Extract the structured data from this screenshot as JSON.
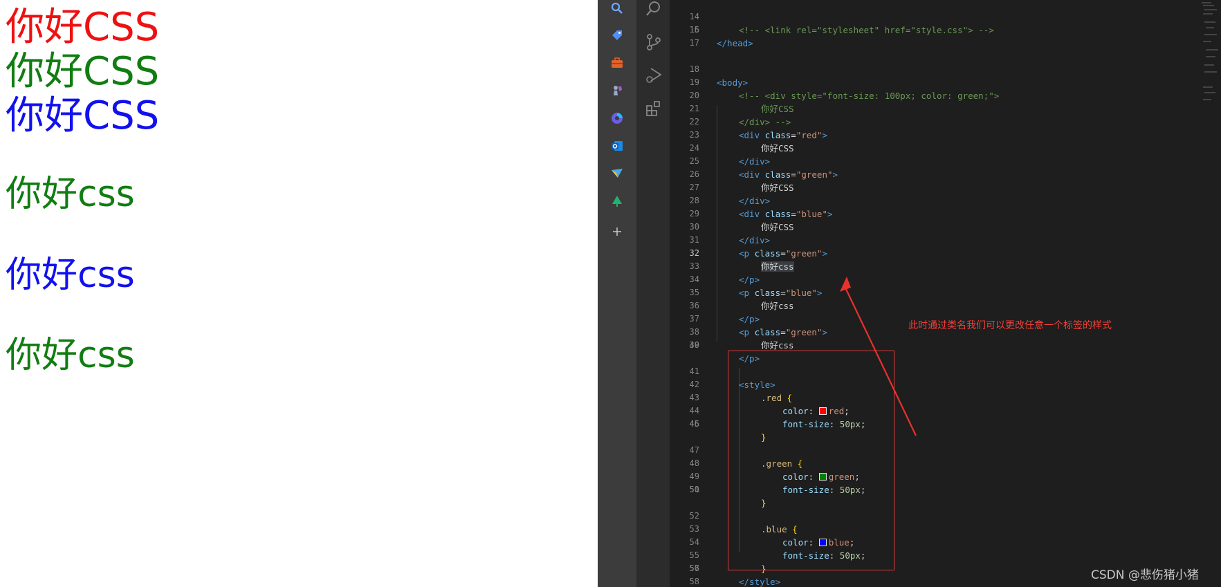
{
  "preview": {
    "lines": [
      {
        "text": "你好CSS",
        "color": "#ee1111"
      },
      {
        "text": "你好CSS",
        "color": "#117d11"
      },
      {
        "text": "你好CSS",
        "color": "#1111ee"
      },
      {
        "text": "你好css",
        "color": "#117d11"
      },
      {
        "text": "你好css",
        "color": "#1111ee"
      },
      {
        "text": "你好css",
        "color": "#117d11"
      }
    ]
  },
  "strip_icons": [
    "search-icon",
    "tag-icon",
    "toolbox-icon",
    "chess-icon",
    "copilot-icon",
    "outlook-icon",
    "send-icon",
    "tree-icon",
    "plus-icon"
  ],
  "activity_icons": [
    "search-icon",
    "source-control-icon",
    "run-debug-icon",
    "extensions-icon"
  ],
  "editor": {
    "active_line": 32,
    "line_numbers": [
      "14",
      "15",
      "16",
      "17",
      "18",
      "19",
      "20",
      "21",
      "22",
      "23",
      "24",
      "25",
      "26",
      "27",
      "28",
      "29",
      "30",
      "31",
      "32",
      "33",
      "34",
      "35",
      "36",
      "37",
      "38",
      "39",
      "40",
      "41",
      "42",
      "43",
      "44",
      "45",
      "46",
      "47",
      "48",
      "49",
      "50",
      "51",
      "52",
      "53",
      "54",
      "55",
      "56",
      "57",
      "58"
    ],
    "code": {
      "l14": "<!-- <link rel=\"stylesheet\" href=\"style.css\"> -->",
      "l15_tag": "</head>",
      "l18_tag": "<body>",
      "l19": "<!-- <div style=\"font-size: 100px; color: green;\">",
      "l20": "你好CSS",
      "l21": "</div> -->",
      "div_open": "<div ",
      "div_close": "</div>",
      "p_open": "<p ",
      "p_close": "</p>",
      "class_attr": "class",
      "eq": "=",
      "gt": ">",
      "red_str": "\"red\"",
      "green_str": "\"green\"",
      "blue_str": "\"blue\"",
      "text_upper": "你好CSS",
      "text_lower": "你好css",
      "style_open": "<style>",
      "style_close": "</style>",
      "sel_red": ".red",
      "sel_green": ".green",
      "sel_blue": ".blue",
      "brace_open": " {",
      "brace_close": "}",
      "prop_color": "color",
      "prop_font_size": "font-size",
      "colon": ": ",
      "val_red": "red",
      "val_green": "green",
      "val_blue": "blue",
      "val_size": "50px",
      "semi": ";"
    },
    "swatch_colors": {
      "red": "#ff0000",
      "green": "#008000",
      "blue": "#0000ff"
    }
  },
  "annotation": "此时通过类名我们可以更改任意一个标签的样式",
  "watermark": "CSDN @悲伤猪小猪"
}
